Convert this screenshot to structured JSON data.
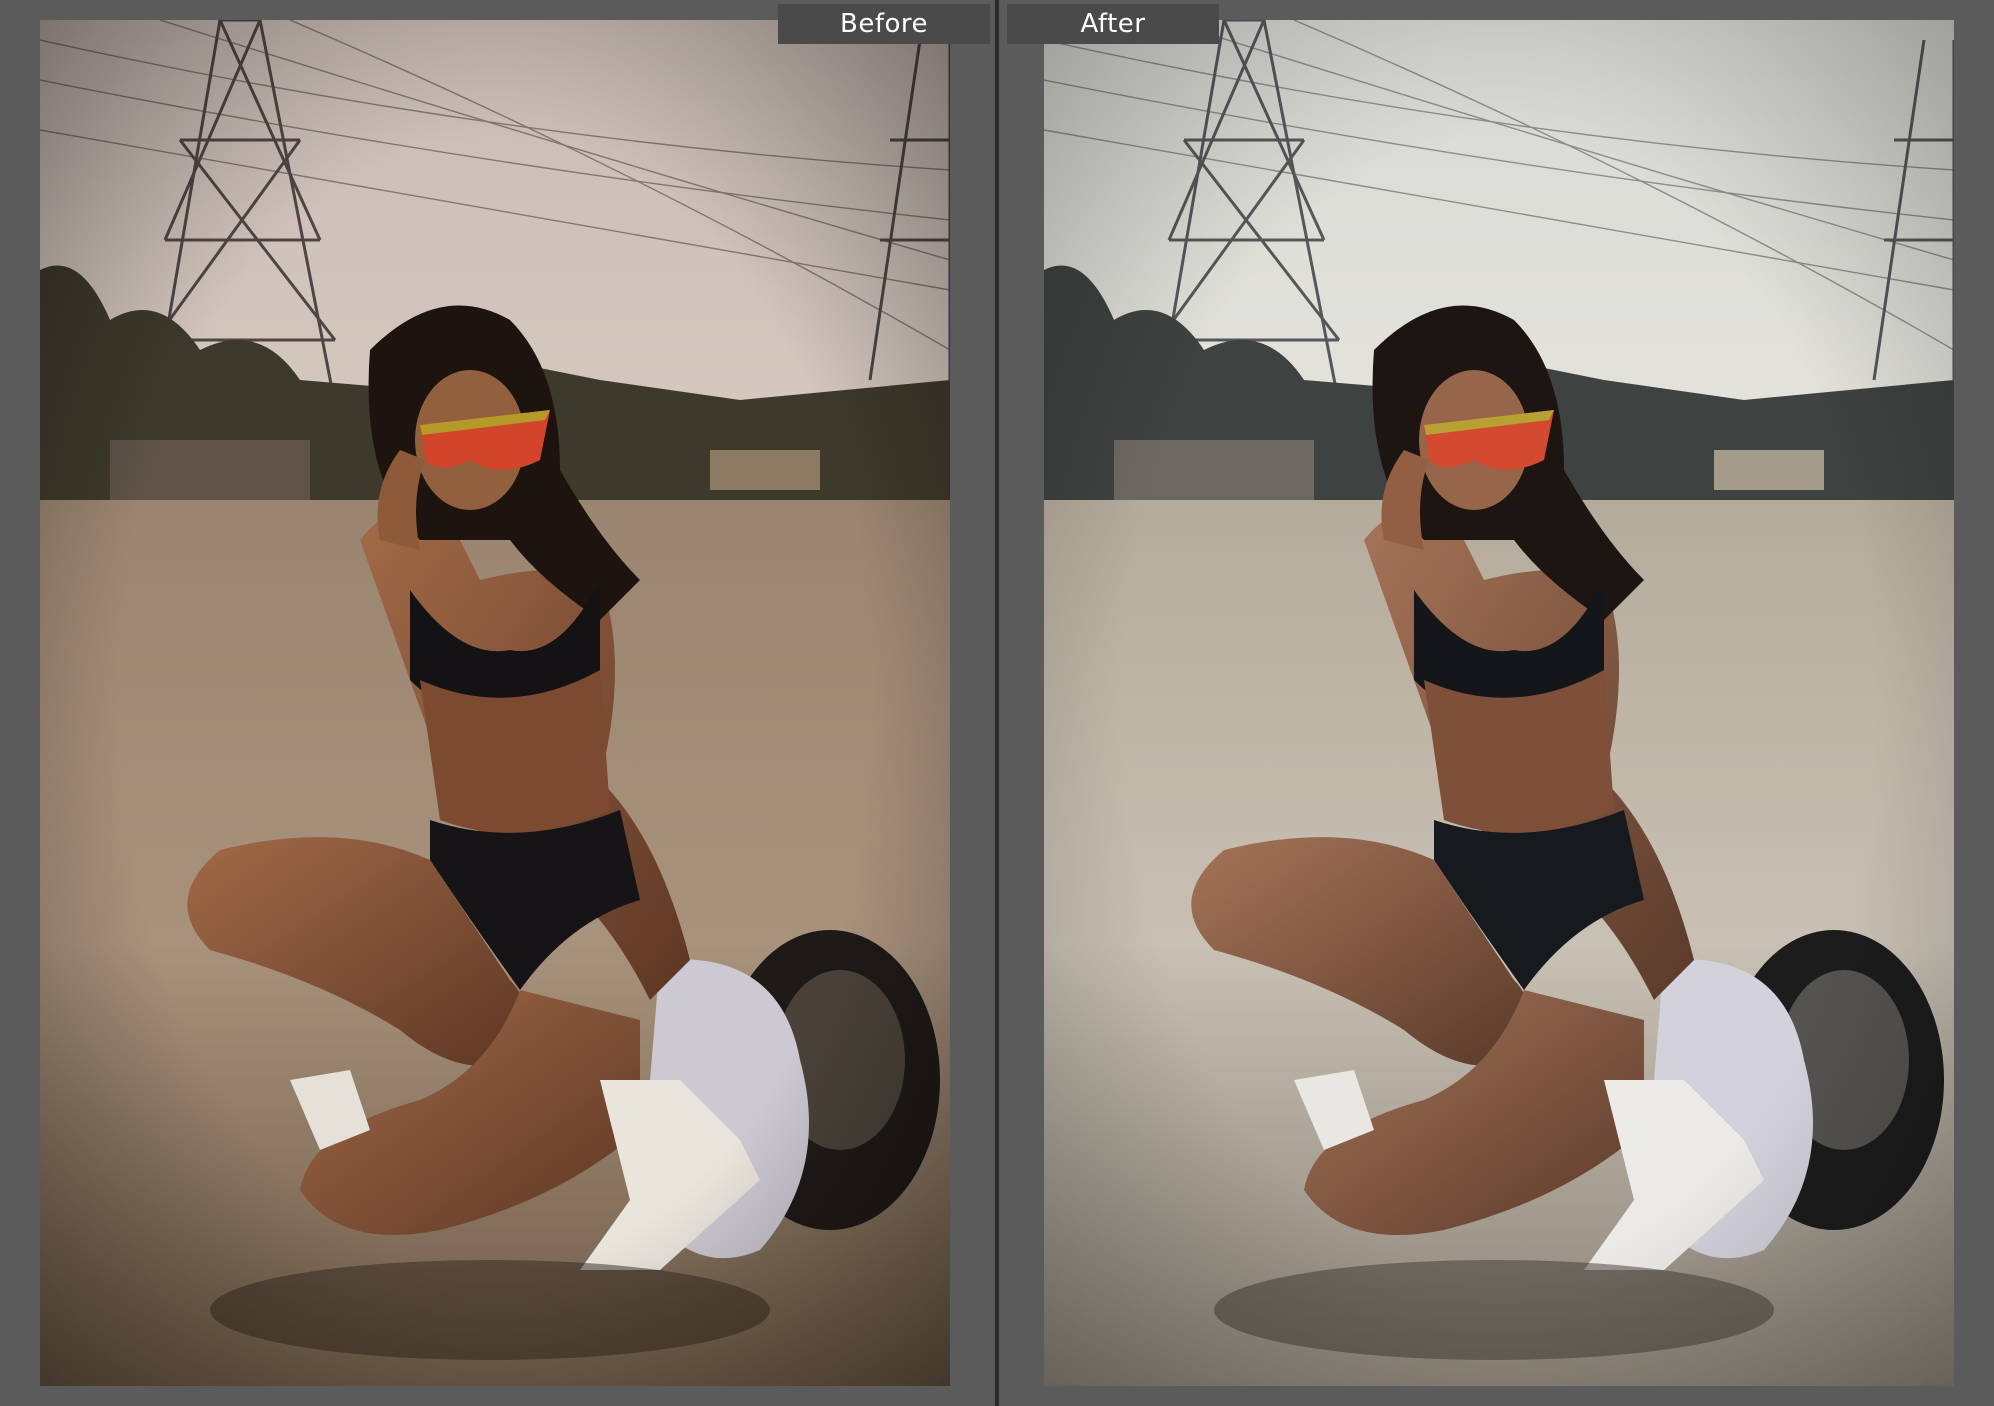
{
  "view": {
    "mode": "before-after-compare",
    "panels": [
      {
        "label": "Before",
        "tone": "warm-muted"
      },
      {
        "label": "After",
        "tone": "cool-bright"
      }
    ]
  },
  "colors": {
    "background": "#585858",
    "label_tab": "#4a4a4a",
    "label_text": "#ffffff",
    "divider": "#2b2b2b",
    "before_sky": "#cfc3bb",
    "before_ground": "#a48f78",
    "after_sky": "#dfe0da",
    "after_ground": "#c4bcaf"
  },
  "icons": {
    "photo_before": "photo-before-icon",
    "photo_after": "photo-after-icon"
  }
}
